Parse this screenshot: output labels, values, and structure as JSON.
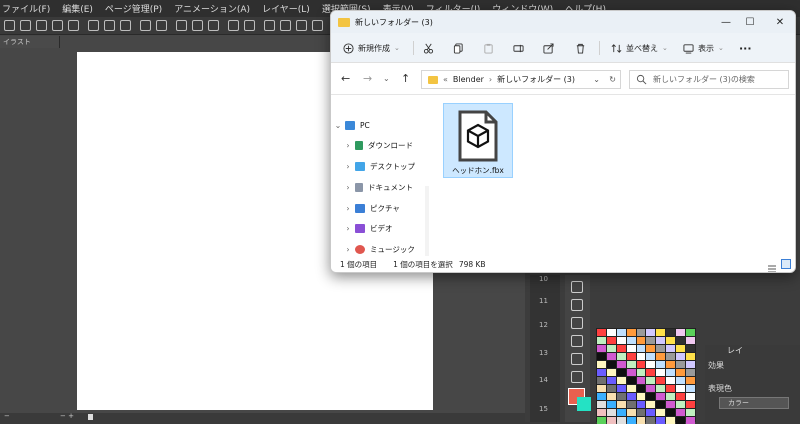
{
  "menubar": {
    "items": [
      "ファイル(F)",
      "編集(E)",
      "ページ管理(P)",
      "アニメーション(A)",
      "レイヤー(L)",
      "選択範囲(S)",
      "表示(V)",
      "フィルター(I)",
      "ウィンドウ(W)",
      "ヘルプ(H)"
    ]
  },
  "doc_tab": {
    "label": "イラスト"
  },
  "right_panel": {
    "tab_label": "レイ",
    "effect_label": "効果",
    "display_color_label": "表現色",
    "color_mode": "カラー"
  },
  "layer_numbers": [
    "10",
    "11",
    "12",
    "13",
    "14",
    "15"
  ],
  "colors": {
    "main_color": "#e8604f",
    "sub_color": "#24e2c4",
    "paper": "#ffffff",
    "file_selected_bg": "#cde8ff"
  },
  "explorer": {
    "title": "新しいフォルダー (3)",
    "window_buttons": {
      "minimize": "—",
      "maximize": "☐",
      "close": "✕"
    },
    "commands": {
      "new": "新規作成",
      "sort": "並べ替え",
      "view": "表示",
      "more": "···"
    },
    "path": [
      "«",
      "Blender",
      "›",
      "新しいフォルダー (3)"
    ],
    "search_placeholder": "新しいフォルダー (3)の検索",
    "nav_items": [
      {
        "label": "PC",
        "icon": "pc-icon"
      },
      {
        "label": "ダウンロード",
        "icon": "download-icon"
      },
      {
        "label": "デスクトップ",
        "icon": "desktop-icon"
      },
      {
        "label": "ドキュメント",
        "icon": "document-icon"
      },
      {
        "label": "ピクチャ",
        "icon": "pictures-icon"
      },
      {
        "label": "ビデオ",
        "icon": "video-icon"
      },
      {
        "label": "ミュージック",
        "icon": "music-icon"
      }
    ],
    "file": {
      "name": "ヘッドホン.fbx",
      "icon": "3d-object-file-icon"
    },
    "status": {
      "count": "1 個の項目",
      "selected": "1 個の項目を選択",
      "size": "798 KB"
    }
  }
}
